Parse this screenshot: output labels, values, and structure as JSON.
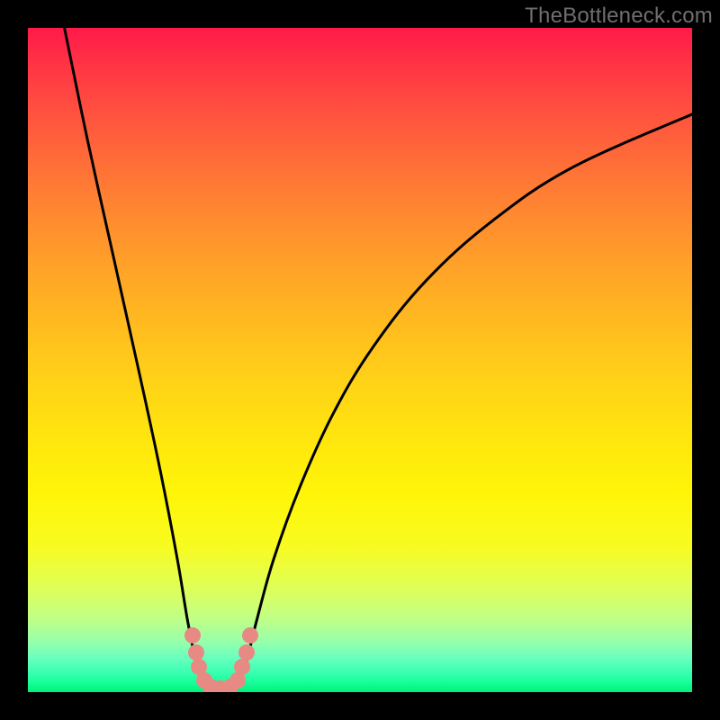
{
  "watermark": "TheBottleneck.com",
  "chart_data": {
    "type": "line",
    "title": "",
    "xlabel": "",
    "ylabel": "",
    "xlim": [
      0,
      100
    ],
    "ylim": [
      0,
      100
    ],
    "grid": false,
    "gradient_stops": [
      {
        "pos": 0,
        "color": "#ff1a4a"
      },
      {
        "pos": 50,
        "color": "#ffd416"
      },
      {
        "pos": 80,
        "color": "#f0ff40"
      },
      {
        "pos": 100,
        "color": "#00f07a"
      }
    ],
    "series": [
      {
        "name": "curve",
        "points": [
          {
            "x": 5.5,
            "y": 100
          },
          {
            "x": 9.0,
            "y": 83
          },
          {
            "x": 13.0,
            "y": 65
          },
          {
            "x": 17.0,
            "y": 47
          },
          {
            "x": 20.0,
            "y": 33
          },
          {
            "x": 22.5,
            "y": 20
          },
          {
            "x": 24.0,
            "y": 11
          },
          {
            "x": 25.2,
            "y": 5
          },
          {
            "x": 26.0,
            "y": 2
          },
          {
            "x": 27.0,
            "y": 0.5
          },
          {
            "x": 29.0,
            "y": 0.3
          },
          {
            "x": 31.0,
            "y": 0.5
          },
          {
            "x": 32.0,
            "y": 2
          },
          {
            "x": 33.0,
            "y": 5
          },
          {
            "x": 34.5,
            "y": 11
          },
          {
            "x": 37.0,
            "y": 20
          },
          {
            "x": 41.0,
            "y": 31
          },
          {
            "x": 46.0,
            "y": 42
          },
          {
            "x": 52.0,
            "y": 52
          },
          {
            "x": 60.0,
            "y": 62
          },
          {
            "x": 70.0,
            "y": 71
          },
          {
            "x": 82.0,
            "y": 79
          },
          {
            "x": 100.0,
            "y": 87
          }
        ]
      }
    ],
    "markers": [
      {
        "x": 24.8,
        "y": 8.5
      },
      {
        "x": 25.3,
        "y": 6.0
      },
      {
        "x": 25.8,
        "y": 3.8
      },
      {
        "x": 26.5,
        "y": 1.8
      },
      {
        "x": 27.5,
        "y": 0.8
      },
      {
        "x": 29.0,
        "y": 0.6
      },
      {
        "x": 30.5,
        "y": 0.8
      },
      {
        "x": 31.6,
        "y": 1.8
      },
      {
        "x": 32.3,
        "y": 3.8
      },
      {
        "x": 32.9,
        "y": 6.0
      },
      {
        "x": 33.5,
        "y": 8.5
      }
    ]
  }
}
